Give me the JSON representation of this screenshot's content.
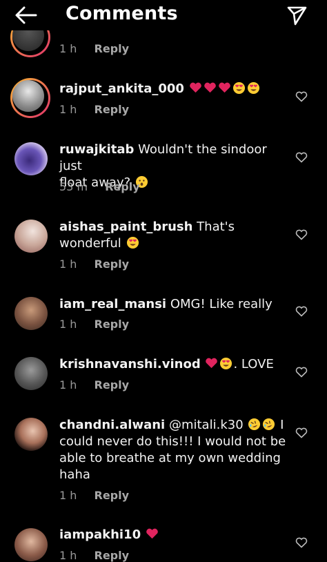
{
  "header": {
    "title": "Comments",
    "back_icon": "arrow-left-icon",
    "send_icon": "paper-plane-icon"
  },
  "comments": [
    {
      "username": "",
      "text": "",
      "time": "1 h",
      "reply": "Reply"
    },
    {
      "username": "rajput_ankita_000",
      "text": "",
      "time": "1 h",
      "reply": "Reply",
      "emojis": [
        "red-heart",
        "red-heart",
        "red-heart",
        "heart-eyes",
        "heart-eyes"
      ]
    },
    {
      "username": "ruwajkitab",
      "text": "Wouldn't the sindoor just",
      "text2": "float away?",
      "time": "53 m",
      "reply": "Reply",
      "emojis": [
        "astonished-face"
      ]
    },
    {
      "username": "aishas_paint_brush",
      "text": "That's",
      "text2": "wonderful",
      "time": "1 h",
      "reply": "Reply",
      "emojis": [
        "heart-eyes"
      ]
    },
    {
      "username": "iam_real_mansi",
      "text": "OMG! Like really",
      "time": "1 h",
      "reply": "Reply"
    },
    {
      "username": "krishnavanshi.vinod",
      "text": ". LOVE",
      "time": "1 h",
      "reply": "Reply",
      "emojis": [
        "red-heart",
        "heart-eyes"
      ]
    },
    {
      "username": "chandni.alwani",
      "text": "@mitali.k30",
      "text_after": "I",
      "text2": "could never do this!!! I would not be",
      "text3": "able to breathe at my own wedding",
      "text4": "haha",
      "time": "1 h",
      "reply": "Reply",
      "emojis": [
        "rolling-laughing",
        "rolling-laughing"
      ]
    },
    {
      "username": "iampakhi10",
      "text": "",
      "time": "1 h",
      "reply": "Reply",
      "emojis": [
        "red-heart"
      ]
    }
  ],
  "colors": {
    "background": "#000000",
    "text": "#f2f2f2",
    "meta": "#9a9a9a",
    "heart": "#e0245e",
    "emoji": "#ffcc33"
  }
}
